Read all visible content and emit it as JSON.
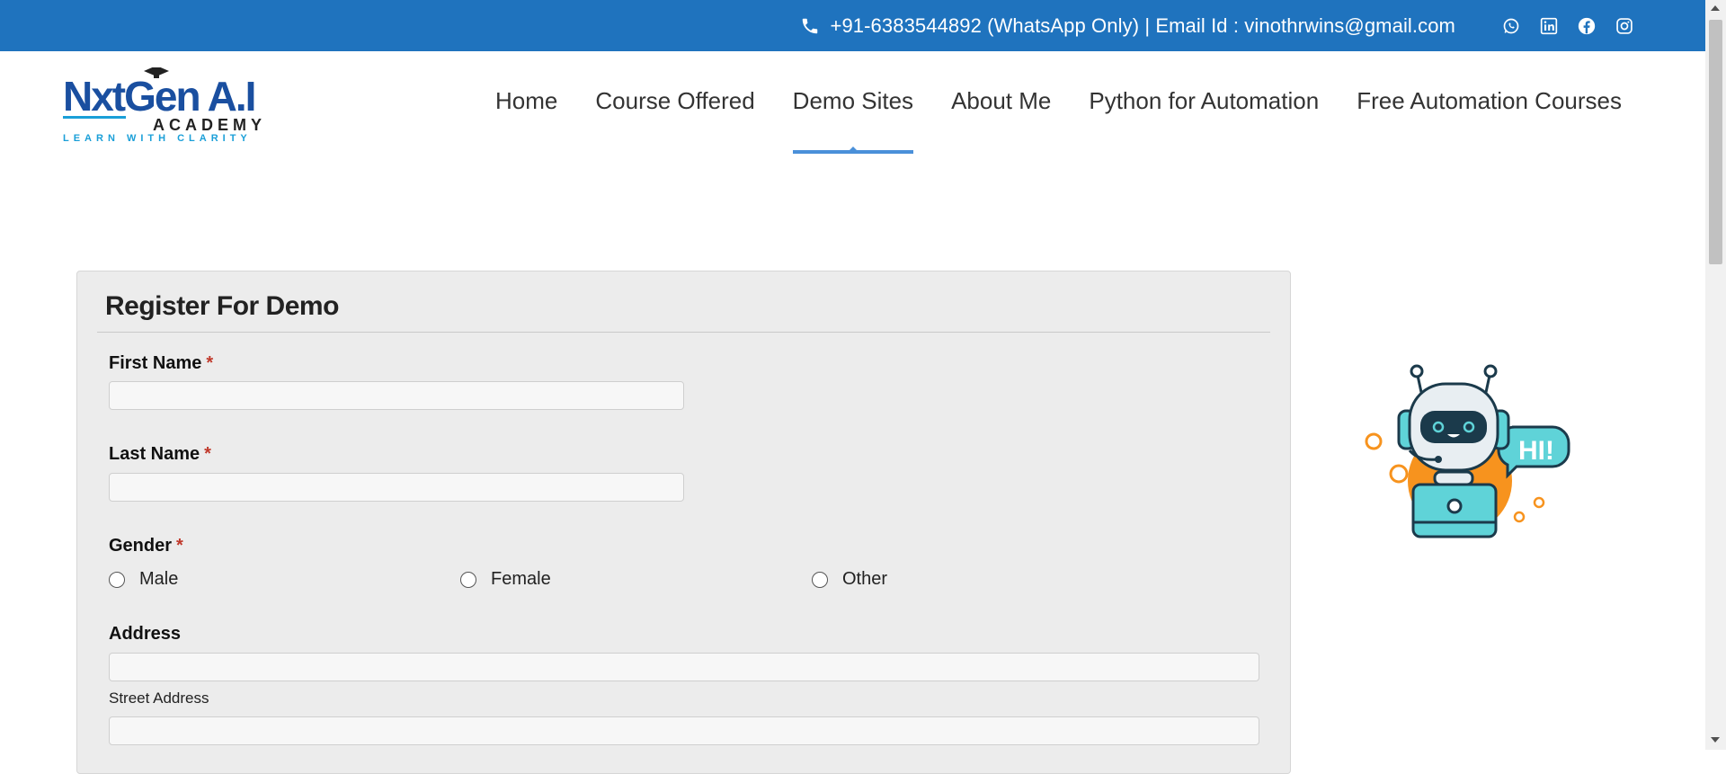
{
  "topbar": {
    "contact_text": "+91-6383544892 (WhatsApp Only) | Email Id : vinothrwins@gmail.com",
    "social_icons": [
      "whatsapp-icon",
      "linkedin-icon",
      "facebook-icon",
      "instagram-icon"
    ]
  },
  "logo": {
    "main": "NxtGen A.I",
    "sub": "ACADEMY",
    "tagline": "LEARN WITH CLARITY"
  },
  "nav": {
    "items": [
      {
        "label": "Home"
      },
      {
        "label": "Course Offered"
      },
      {
        "label": "Demo Sites"
      },
      {
        "label": "About Me"
      },
      {
        "label": "Python for Automation"
      },
      {
        "label": "Free Automation Courses"
      }
    ],
    "active": "Demo Sites"
  },
  "form": {
    "title": "Register For Demo",
    "first_name_label": "First Name",
    "last_name_label": "Last Name",
    "gender_label": "Gender",
    "required_mark": "*",
    "gender_options": [
      "Male",
      "Female",
      "Other"
    ],
    "address_label": "Address",
    "street_address_label": "Street Address",
    "first_name_value": "",
    "last_name_value": "",
    "street_address_value": ""
  },
  "robot": {
    "speech_text": "HI!"
  },
  "colors": {
    "topbar_bg": "#1f73be",
    "nav_active": "#4a90d9",
    "card_bg": "#ececec",
    "required": "#c0392b"
  }
}
